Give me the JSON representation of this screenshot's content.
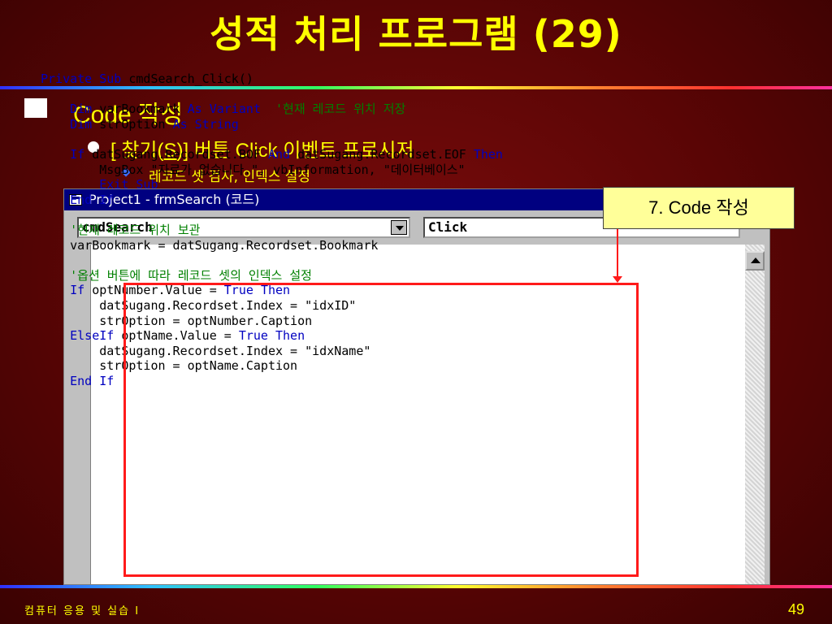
{
  "slide": {
    "title": "성적 처리 프로그램 (29)",
    "bullet_l1": "Code 작성",
    "bullet_l2_prefix": "[ 찾기(",
    "bullet_l2_key": "S",
    "bullet_l2_suffix": ")] 버튼 Click 이벤트 프로시저",
    "bullet_l3": "레코드 셋 검사, 인덱스 설정",
    "footer": "컴퓨터 응용 및 실습 I",
    "page_number": "49"
  },
  "window": {
    "title": "Project1 - frmSearch (코드)",
    "object_combo": "cmdSearch",
    "proc_combo": "Click"
  },
  "code_lines": [
    "Private Sub cmdSearch_Click()",
    "",
    "    Dim varBookmark As Variant  '현재 레코드 위치 저장",
    "    Dim strOption As String",
    "",
    "    If datSugang.Recordset.BOF And datSugang.Recordset.EOF Then",
    "        MsgBox \"자료가 없습니다.\", vbInformation, \"데이터베이스\"",
    "        Exit Sub",
    "    End If",
    "",
    "    '현재 레코드 위치 보관",
    "    varBookmark = datSugang.Recordset.Bookmark",
    "",
    "    '옵션 버튼에 따라 레코드 셋의 인덱스 설정",
    "    If optNumber.Value = True Then",
    "        datSugang.Recordset.Index = \"idxID\"",
    "        strOption = optNumber.Caption",
    "    ElseIf optName.Value = True Then",
    "        datSugang.Recordset.Index = \"idxName\"",
    "        strOption = optName.Caption",
    "    End If"
  ],
  "callout": "7. Code 작성",
  "colors": {
    "background": "#5a0505",
    "title_text": "#ffff00",
    "titlebar": "#000080",
    "keyword": "#0000c0",
    "comment": "#008000",
    "highlight_box": "#ff1a1a",
    "callout_bg": "#ffff99"
  }
}
